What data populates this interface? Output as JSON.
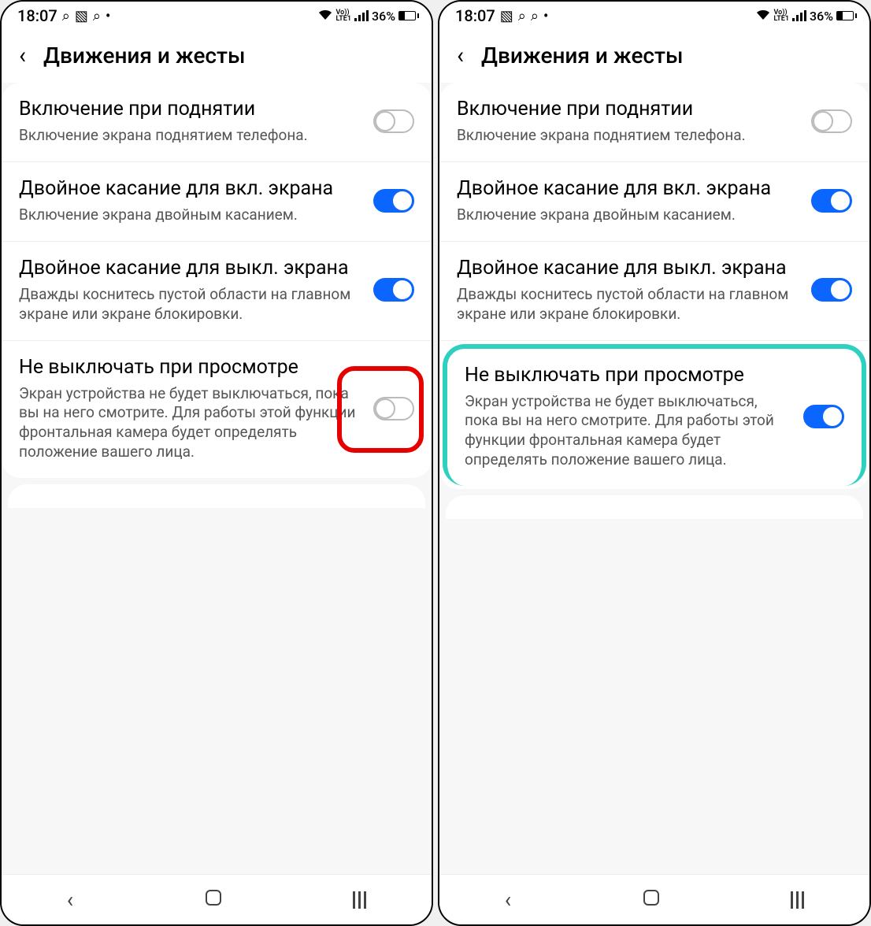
{
  "status": {
    "time": "18:07",
    "battery_pct": "36%"
  },
  "header": {
    "title": "Движения и жесты"
  },
  "settings": [
    {
      "title": "Включение при поднятии",
      "desc": "Включение экрана поднятием телефона.",
      "on": false
    },
    {
      "title": "Двойное касание для вкл. экрана",
      "desc": "Включение экрана двойным касанием.",
      "on": true
    },
    {
      "title": "Двойное касание для выкл. экрана",
      "desc": "Дважды коснитесь пустой области на главном экране или экране блокировки.",
      "on": true
    },
    {
      "title": "Не выключать при просмотре",
      "desc": "Экран устройства не будет выключаться, пока вы на него смотрите. Для работы этой функции фронтальная камера будет определять положение вашего лица.",
      "on_left": false,
      "on_right": true
    }
  ],
  "screens": {
    "left": {
      "status_icons_order": "search-gallery-search-dot"
    },
    "right": {
      "status_icons_order": "gallery-search-search-dot"
    }
  }
}
